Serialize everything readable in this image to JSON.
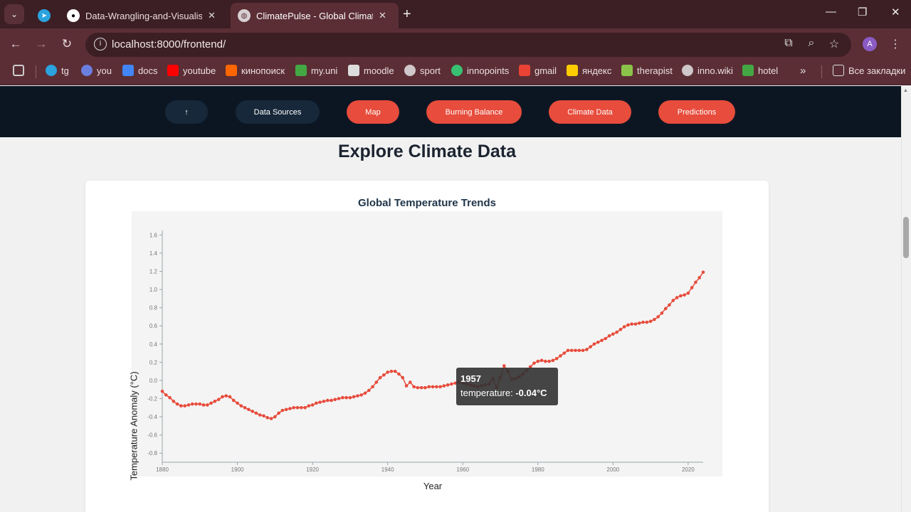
{
  "browser": {
    "tabs": [
      {
        "label": "Data-Wrangling-and-Visualisati",
        "icon": "github-icon"
      },
      {
        "label": "ClimatePulse - Global Climate C",
        "icon": "globe-icon"
      }
    ],
    "url": "localhost:8000/frontend/",
    "profile_initial": "A",
    "bookmarks": [
      "tg",
      "you",
      "docs",
      "youtube",
      "кинопоиск",
      "my.uni",
      "moodle",
      "sport",
      "innopoints",
      "gmail",
      "яндекс",
      "therapist",
      "inno.wiki",
      "hotel"
    ],
    "all_bookmarks": "Все закладки"
  },
  "nav": {
    "top": "↑",
    "data_sources": "Data Sources",
    "map": "Map",
    "burning_balance": "Burning Balance",
    "climate_data": "Climate Data",
    "predictions": "Predictions"
  },
  "page": {
    "heading": "Explore Climate Data"
  },
  "colors": {
    "accent_red": "#e74c3c",
    "nav_dark": "#0b1622",
    "pill_dark": "#17283a"
  },
  "chart_data": {
    "type": "line",
    "title": "Global Temperature Trends",
    "xlabel": "Year",
    "ylabel": "Temperature Anomaly (°C)",
    "xlim": [
      1880,
      2024
    ],
    "ylim": [
      -0.9,
      1.65
    ],
    "xticks": [
      1880,
      1900,
      1920,
      1940,
      1960,
      1980,
      2000,
      2020
    ],
    "yticks": [
      -0.8,
      -0.6,
      -0.4,
      -0.2,
      0.0,
      0.2,
      0.4,
      0.6,
      0.8,
      1.0,
      1.2,
      1.4,
      1.6
    ],
    "grid": false,
    "series": [
      {
        "color": "#e74c3c",
        "x": [
          1880,
          1881,
          1882,
          1883,
          1884,
          1885,
          1886,
          1887,
          1888,
          1889,
          1890,
          1891,
          1892,
          1893,
          1894,
          1895,
          1896,
          1897,
          1898,
          1899,
          1900,
          1901,
          1902,
          1903,
          1904,
          1905,
          1906,
          1907,
          1908,
          1909,
          1910,
          1911,
          1912,
          1913,
          1914,
          1915,
          1916,
          1917,
          1918,
          1919,
          1920,
          1921,
          1922,
          1923,
          1924,
          1925,
          1926,
          1927,
          1928,
          1929,
          1930,
          1931,
          1932,
          1933,
          1934,
          1935,
          1936,
          1937,
          1938,
          1939,
          1940,
          1941,
          1942,
          1943,
          1944,
          1945,
          1946,
          1947,
          1948,
          1949,
          1950,
          1951,
          1952,
          1953,
          1954,
          1955,
          1956,
          1957,
          1958,
          1959,
          1960,
          1961,
          1962,
          1963,
          1964,
          1965,
          1966,
          1967,
          1968,
          1969,
          1970,
          1971,
          1972,
          1973,
          1974,
          1975,
          1976,
          1977,
          1978,
          1979,
          1980,
          1981,
          1982,
          1983,
          1984,
          1985,
          1986,
          1987,
          1988,
          1989,
          1990,
          1991,
          1992,
          1993,
          1994,
          1995,
          1996,
          1997,
          1998,
          1999,
          2000,
          2001,
          2002,
          2003,
          2004,
          2005,
          2006,
          2007,
          2008,
          2009,
          2010,
          2011,
          2012,
          2013,
          2014,
          2015,
          2016,
          2017,
          2018,
          2019,
          2020,
          2021,
          2022,
          2023,
          2024
        ],
        "y": [
          -0.12,
          -0.16,
          -0.19,
          -0.23,
          -0.26,
          -0.28,
          -0.28,
          -0.27,
          -0.26,
          -0.26,
          -0.26,
          -0.27,
          -0.27,
          -0.25,
          -0.23,
          -0.21,
          -0.18,
          -0.17,
          -0.18,
          -0.22,
          -0.25,
          -0.28,
          -0.3,
          -0.32,
          -0.34,
          -0.36,
          -0.38,
          -0.39,
          -0.41,
          -0.42,
          -0.4,
          -0.36,
          -0.33,
          -0.32,
          -0.31,
          -0.3,
          -0.3,
          -0.3,
          -0.3,
          -0.28,
          -0.27,
          -0.25,
          -0.24,
          -0.23,
          -0.22,
          -0.22,
          -0.21,
          -0.2,
          -0.19,
          -0.19,
          -0.19,
          -0.18,
          -0.17,
          -0.16,
          -0.14,
          -0.11,
          -0.07,
          -0.02,
          0.03,
          0.06,
          0.09,
          0.1,
          0.1,
          0.07,
          0.03,
          -0.06,
          -0.02,
          -0.07,
          -0.08,
          -0.08,
          -0.08,
          -0.07,
          -0.07,
          -0.07,
          -0.07,
          -0.06,
          -0.05,
          -0.04,
          -0.03,
          -0.02,
          -0.03,
          -0.04,
          -0.05,
          -0.06,
          -0.07,
          -0.06,
          -0.05,
          -0.04,
          0.02,
          -0.08,
          0.03,
          0.16,
          0.1,
          0.01,
          0.02,
          0.04,
          0.07,
          0.11,
          0.15,
          0.19,
          0.21,
          0.22,
          0.21,
          0.21,
          0.22,
          0.24,
          0.27,
          0.3,
          0.33,
          0.33,
          0.33,
          0.33,
          0.33,
          0.34,
          0.37,
          0.4,
          0.42,
          0.44,
          0.46,
          0.49,
          0.51,
          0.53,
          0.56,
          0.59,
          0.61,
          0.62,
          0.62,
          0.63,
          0.64,
          0.64,
          0.65,
          0.67,
          0.7,
          0.74,
          0.79,
          0.83,
          0.88,
          0.91,
          0.93,
          0.94,
          0.96,
          1.02,
          1.08,
          1.13,
          1.19
        ]
      }
    ],
    "tooltip": {
      "year": "1957",
      "label": "temperature: ",
      "value": "-0.04°C"
    }
  }
}
